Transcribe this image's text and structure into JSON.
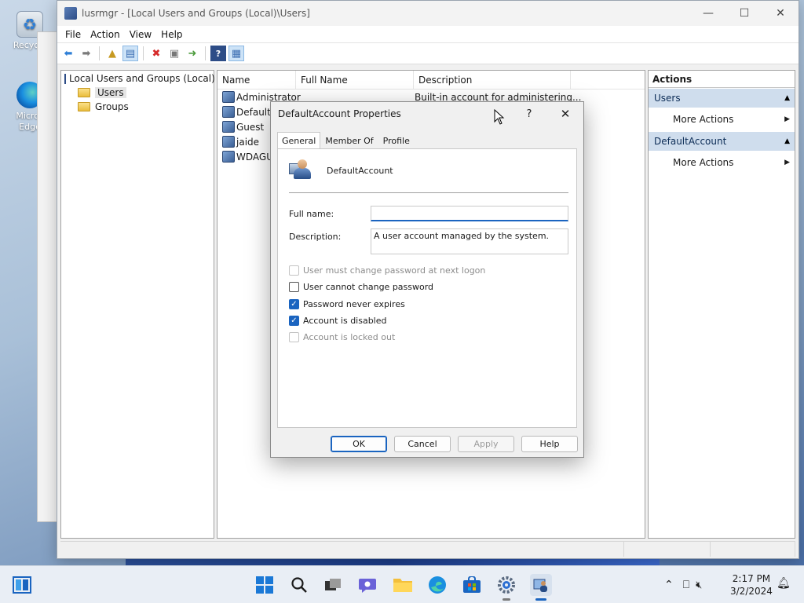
{
  "desktop": {
    "icons": [
      {
        "label": "Recycle"
      },
      {
        "label": "Micros Edge"
      }
    ]
  },
  "window": {
    "title": "lusrmgr - [Local Users and Groups (Local)\\Users]",
    "controls": {
      "minimize": "—",
      "maximize": "☐",
      "close": "✕"
    },
    "menu": [
      "File",
      "Action",
      "View",
      "Help"
    ]
  },
  "tree": {
    "root": "Local Users and Groups (Local)",
    "items": [
      "Users",
      "Groups"
    ]
  },
  "list": {
    "columns": [
      "Name",
      "Full Name",
      "Description"
    ],
    "rows": [
      {
        "name": "Administrator",
        "full_name": "",
        "description": "Built-in account for administering..."
      },
      {
        "name": "DefaultA",
        "full_name": "",
        "description": ""
      },
      {
        "name": "Guest",
        "full_name": "",
        "description": ""
      },
      {
        "name": "jaide",
        "full_name": "",
        "description": ""
      },
      {
        "name": "WDAGUt",
        "full_name": "",
        "description": ""
      }
    ]
  },
  "actions": {
    "header": "Actions",
    "sections": [
      {
        "title": "Users",
        "item": "More Actions"
      },
      {
        "title": "DefaultAccount",
        "item": "More Actions"
      }
    ]
  },
  "dialog": {
    "title": "DefaultAccount Properties",
    "help": "?",
    "close": "✕",
    "tabs": [
      "General",
      "Member Of",
      "Profile"
    ],
    "active_tab": "General",
    "account_name": "DefaultAccount",
    "full_name_label": "Full name:",
    "full_name_value": "",
    "description_label": "Description:",
    "description_value": "A user account managed by the system.",
    "checkboxes": [
      {
        "label": "User must change password at next logon",
        "checked": false,
        "disabled": true
      },
      {
        "label": "User cannot change password",
        "checked": false,
        "disabled": false
      },
      {
        "label": "Password never expires",
        "checked": true,
        "disabled": false
      },
      {
        "label": "Account is disabled",
        "checked": true,
        "disabled": false
      },
      {
        "label": "Account is locked out",
        "checked": false,
        "disabled": true
      }
    ],
    "buttons": {
      "ok": "OK",
      "cancel": "Cancel",
      "apply": "Apply",
      "help": "Help"
    }
  },
  "taskbar": {
    "time": "2:17 PM",
    "date": "3/2/2024"
  },
  "colors": {
    "accent": "#1a64c0",
    "actions_section": "#cfdded"
  }
}
